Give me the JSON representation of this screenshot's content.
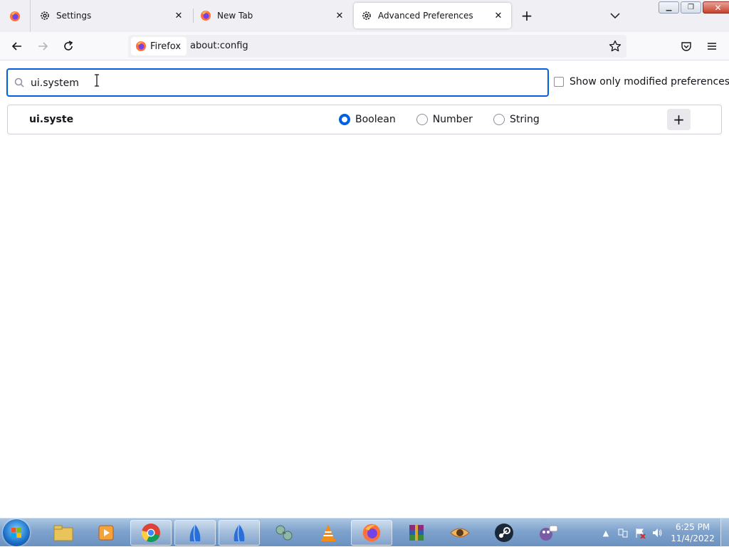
{
  "browser": {
    "tabs": [
      {
        "title": "Settings",
        "icon": "gear-icon"
      },
      {
        "title": "New Tab",
        "icon": "firefox-icon"
      },
      {
        "title": "Advanced Preferences",
        "icon": "gear-icon"
      }
    ],
    "identity_label": "Firefox",
    "url": "about:config"
  },
  "config": {
    "search_value": "ui.system",
    "show_modified_label": "Show only modified preferences",
    "new_pref_name": "ui.syste",
    "types": [
      "Boolean",
      "Number",
      "String"
    ],
    "selected_type": "Boolean",
    "add_symbol": "+"
  },
  "taskbar": {
    "time": "6:25 PM",
    "date": "11/4/2022",
    "apps": [
      "file-explorer-icon",
      "media-player-icon",
      "chrome-icon",
      "app-sail-icon",
      "app-sail-icon",
      "network-tool-icon",
      "vlc-icon",
      "firefox-icon",
      "winrar-icon",
      "eye-app-icon",
      "steam-icon",
      "chat-bird-icon"
    ]
  },
  "colors": {
    "accent": "#0061e0",
    "taskbar": "#7fa3cd"
  }
}
